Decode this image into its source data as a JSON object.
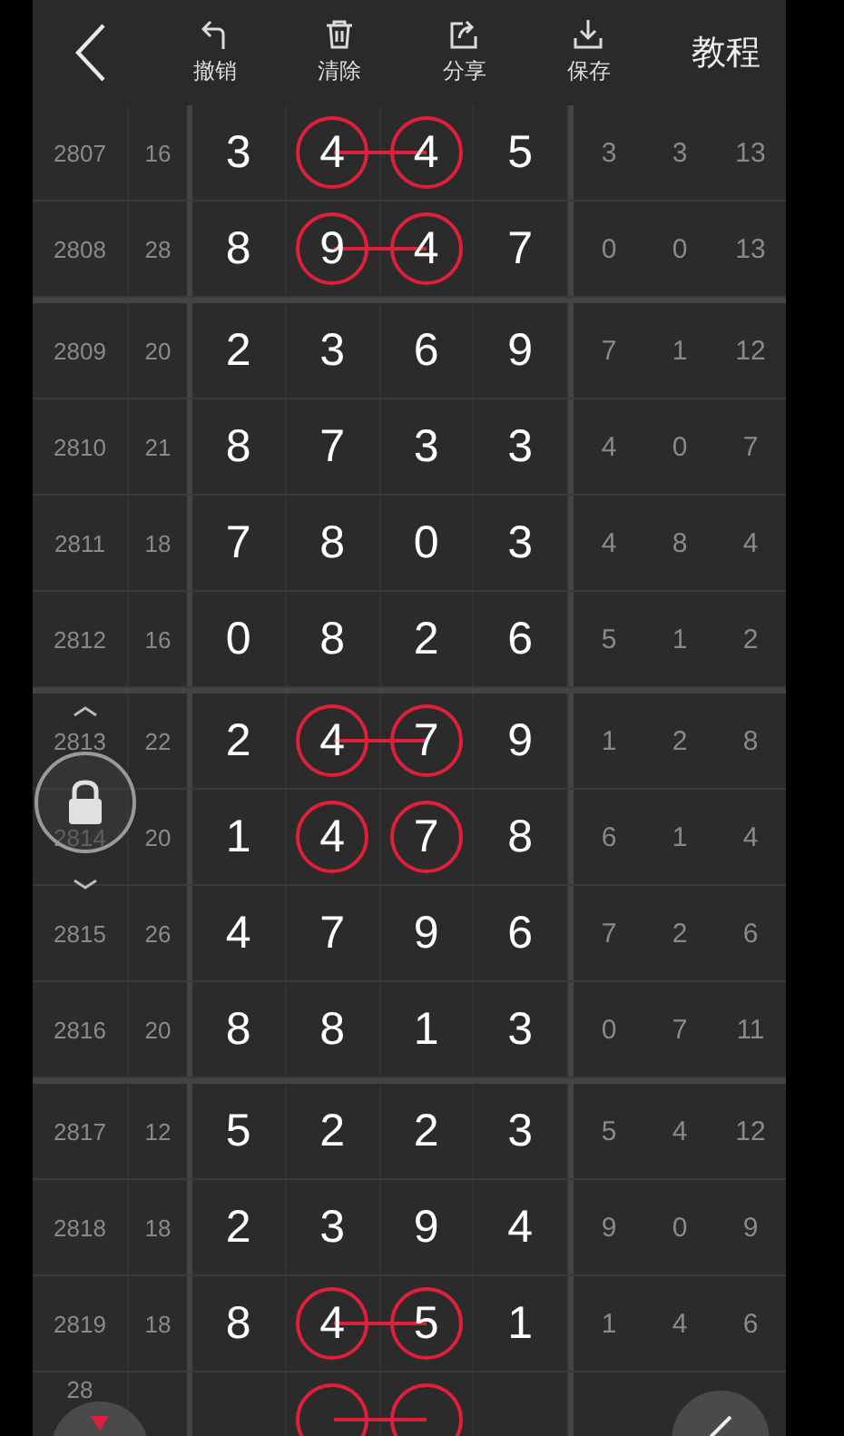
{
  "toolbar": {
    "actions": [
      {
        "kind": "undo",
        "label": "撤销"
      },
      {
        "kind": "clear",
        "label": "清除"
      },
      {
        "kind": "share",
        "label": "分享"
      },
      {
        "kind": "save",
        "label": "保存"
      }
    ],
    "tutorial": "教程"
  },
  "groups": [
    {
      "rows": [
        {
          "issue": "2807",
          "sum": "16",
          "digits": [
            {
              "value": "3",
              "circled": false
            },
            {
              "value": "4",
              "circled": true
            },
            {
              "value": "4",
              "circled": true
            },
            {
              "value": "5",
              "circled": false
            }
          ],
          "link": true,
          "stats": [
            "3",
            "3",
            "13"
          ]
        },
        {
          "issue": "2808",
          "sum": "28",
          "digits": [
            {
              "value": "8",
              "circled": false
            },
            {
              "value": "9",
              "circled": true
            },
            {
              "value": "4",
              "circled": true
            },
            {
              "value": "7",
              "circled": false
            }
          ],
          "link": true,
          "stats": [
            "0",
            "0",
            "13"
          ]
        }
      ]
    },
    {
      "rows": [
        {
          "issue": "2809",
          "sum": "20",
          "digits": [
            {
              "value": "2",
              "circled": false
            },
            {
              "value": "3",
              "circled": false
            },
            {
              "value": "6",
              "circled": false
            },
            {
              "value": "9",
              "circled": false
            }
          ],
          "stats": [
            "7",
            "1",
            "12"
          ]
        },
        {
          "issue": "2810",
          "sum": "21",
          "digits": [
            {
              "value": "8",
              "circled": false
            },
            {
              "value": "7",
              "circled": false
            },
            {
              "value": "3",
              "circled": false
            },
            {
              "value": "3",
              "circled": false
            }
          ],
          "stats": [
            "4",
            "0",
            "7"
          ]
        },
        {
          "issue": "2811",
          "sum": "18",
          "digits": [
            {
              "value": "7",
              "circled": false
            },
            {
              "value": "8",
              "circled": false
            },
            {
              "value": "0",
              "circled": false
            },
            {
              "value": "3",
              "circled": false
            }
          ],
          "stats": [
            "4",
            "8",
            "4"
          ]
        },
        {
          "issue": "2812",
          "sum": "16",
          "digits": [
            {
              "value": "0",
              "circled": false
            },
            {
              "value": "8",
              "circled": false
            },
            {
              "value": "2",
              "circled": false
            },
            {
              "value": "6",
              "circled": false
            }
          ],
          "stats": [
            "5",
            "1",
            "2"
          ]
        }
      ]
    },
    {
      "rows": [
        {
          "issue": "2813",
          "sum": "22",
          "digits": [
            {
              "value": "2",
              "circled": false
            },
            {
              "value": "4",
              "circled": true
            },
            {
              "value": "7",
              "circled": true
            },
            {
              "value": "9",
              "circled": false
            }
          ],
          "link": true,
          "stats": [
            "1",
            "2",
            "8"
          ]
        },
        {
          "issue": "2814",
          "sum": "20",
          "digits": [
            {
              "value": "1",
              "circled": false
            },
            {
              "value": "4",
              "circled": true
            },
            {
              "value": "7",
              "circled": true
            },
            {
              "value": "8",
              "circled": false
            }
          ],
          "link": false,
          "stats": [
            "6",
            "1",
            "4"
          ]
        },
        {
          "issue": "2815",
          "sum": "26",
          "digits": [
            {
              "value": "4",
              "circled": false
            },
            {
              "value": "7",
              "circled": false
            },
            {
              "value": "9",
              "circled": false
            },
            {
              "value": "6",
              "circled": false
            }
          ],
          "stats": [
            "7",
            "2",
            "6"
          ]
        },
        {
          "issue": "2816",
          "sum": "20",
          "digits": [
            {
              "value": "8",
              "circled": false
            },
            {
              "value": "8",
              "circled": false
            },
            {
              "value": "1",
              "circled": false
            },
            {
              "value": "3",
              "circled": false
            }
          ],
          "stats": [
            "0",
            "7",
            "11"
          ]
        }
      ]
    },
    {
      "rows": [
        {
          "issue": "2817",
          "sum": "12",
          "digits": [
            {
              "value": "5",
              "circled": false
            },
            {
              "value": "2",
              "circled": false
            },
            {
              "value": "2",
              "circled": false
            },
            {
              "value": "3",
              "circled": false
            }
          ],
          "stats": [
            "5",
            "4",
            "12"
          ]
        },
        {
          "issue": "2818",
          "sum": "18",
          "digits": [
            {
              "value": "2",
              "circled": false
            },
            {
              "value": "3",
              "circled": false
            },
            {
              "value": "9",
              "circled": false
            },
            {
              "value": "4",
              "circled": false
            }
          ],
          "stats": [
            "9",
            "0",
            "9"
          ]
        },
        {
          "issue": "2819",
          "sum": "18",
          "digits": [
            {
              "value": "8",
              "circled": false
            },
            {
              "value": "4",
              "circled": true
            },
            {
              "value": "5",
              "circled": true
            },
            {
              "value": "1",
              "circled": false
            }
          ],
          "link": true,
          "stats": [
            "1",
            "4",
            "6"
          ]
        },
        {
          "issue": "28",
          "digits": [
            {
              "circled": false
            },
            {
              "circled": true
            },
            {
              "circled": true
            },
            {
              "circled": false
            }
          ],
          "link": true
        }
      ]
    }
  ]
}
